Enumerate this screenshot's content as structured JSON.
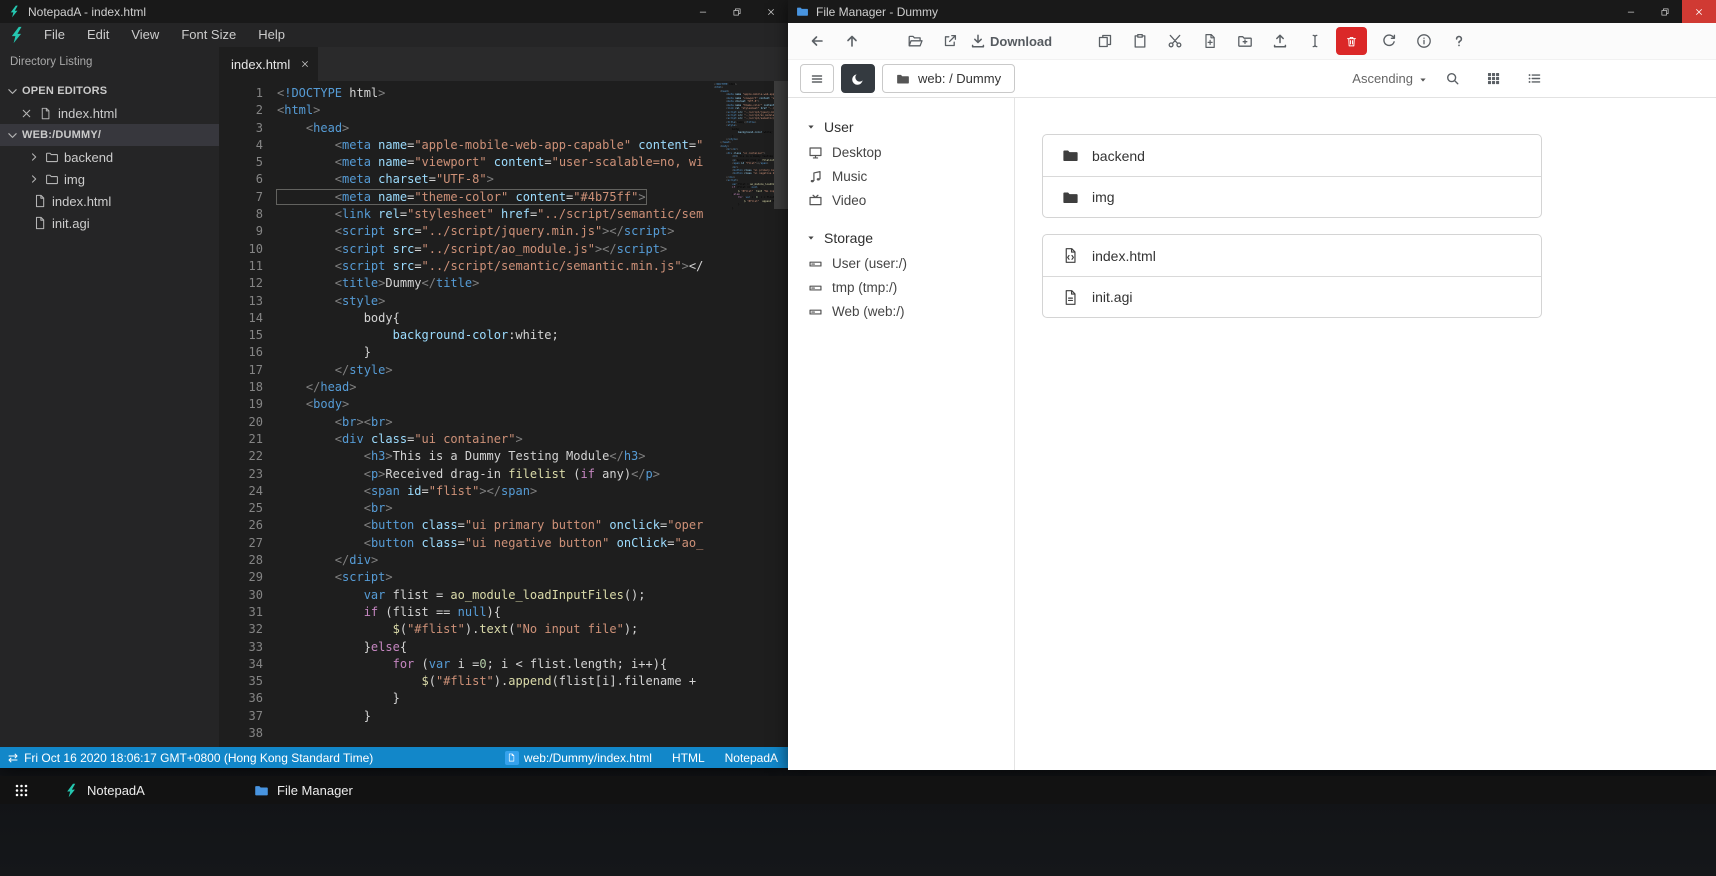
{
  "notepada": {
    "title": "NotepadA - index.html",
    "menu": [
      "File",
      "Edit",
      "View",
      "Font Size",
      "Help"
    ],
    "sidebar_header": "Directory Listing",
    "open_editors_label": "OPEN EDITORS",
    "open_editors": [
      {
        "name": "index.html",
        "icon": "file"
      }
    ],
    "workspace_label": "WEB:/DUMMY/",
    "tree": [
      {
        "name": "backend",
        "icon": "folder"
      },
      {
        "name": "img",
        "icon": "folder"
      },
      {
        "name": "index.html",
        "icon": "file"
      },
      {
        "name": "init.agi",
        "icon": "file"
      }
    ],
    "tab": {
      "label": "index.html"
    },
    "highlight_line": 7,
    "code": [
      "<!DOCTYPE html>",
      "<html>",
      "    <head>",
      "        <meta name=\"apple-mobile-web-app-capable\" content=\"",
      "        <meta name=\"viewport\" content=\"user-scalable=no, wi",
      "        <meta charset=\"UTF-8\">",
      "        <meta name=\"theme-color\" content=\"#4b75ff\">",
      "        <link rel=\"stylesheet\" href=\"../script/semantic/sem",
      "        <script src=\"../script/jquery.min.js\"></script>",
      "        <script src=\"../script/ao_module.js\"></script>",
      "        <script src=\"../script/semantic/semantic.min.js\"></",
      "        <title>Dummy</title>",
      "        <style>",
      "            body{",
      "                background-color:white;",
      "            }",
      "        </style>",
      "    </head>",
      "    <body>",
      "        <br><br>",
      "        <div class=\"ui container\">",
      "            <h3>This is a Dummy Testing Module</h3>",
      "            <p>Received drag-in filelist (if any)</p>",
      "            <span id=\"flist\"></span>",
      "            <br>",
      "            <button class=\"ui primary button\" onclick=\"oper",
      "            <button class=\"ui negative button\" onClick=\"ao_",
      "        </div>",
      "        <script>",
      "            var flist = ao_module_loadInputFiles();",
      "            if (flist == null){",
      "                $(\"#flist\").text(\"No input file\");",
      "            }else{",
      "                for (var i =0; i < flist.length; i++){",
      "                    $(\"#flist\").append(flist[i].filename + ",
      "                }",
      "            }",
      ""
    ],
    "status": {
      "datetime": "Fri Oct 16 2020 18:06:17 GMT+0800 (Hong Kong Standard Time)",
      "path": "web:/Dummy/index.html",
      "language": "HTML",
      "app_name": "NotepadA"
    }
  },
  "filemanager": {
    "title": "File Manager - Dummy",
    "toolbar": [
      {
        "icon": "arrow-left",
        "name": "back-button"
      },
      {
        "icon": "arrow-up",
        "name": "up-button"
      },
      {
        "spacer": true
      },
      {
        "icon": "folder-open",
        "name": "open-button"
      },
      {
        "icon": "external-link",
        "name": "open-in-new-button"
      },
      {
        "icon": "download",
        "name": "download-button",
        "label": "Download"
      },
      {
        "spacer": true
      },
      {
        "icon": "copy",
        "name": "copy-button"
      },
      {
        "icon": "paste",
        "name": "paste-button"
      },
      {
        "icon": "cut",
        "name": "cut-button"
      },
      {
        "icon": "file-plus",
        "name": "new-file-button"
      },
      {
        "icon": "folder-plus",
        "name": "new-folder-button"
      },
      {
        "icon": "upload",
        "name": "upload-button"
      },
      {
        "icon": "i-cursor",
        "name": "rename-button"
      },
      {
        "icon": "trash",
        "name": "delete-button",
        "style": "danger"
      },
      {
        "icon": "refresh",
        "name": "refresh-button"
      },
      {
        "icon": "info",
        "name": "info-button"
      },
      {
        "icon": "question",
        "name": "help-button"
      }
    ],
    "breadcrumb": "web: / Dummy",
    "sort_label": "Ascending",
    "sidebar": [
      {
        "label": "User",
        "items": [
          {
            "name": "Desktop",
            "icon": "desktop"
          },
          {
            "name": "Music",
            "icon": "music"
          },
          {
            "name": "Video",
            "icon": "tv"
          }
        ]
      },
      {
        "label": "Storage",
        "items": [
          {
            "name": "User (user:/)",
            "icon": "hdd"
          },
          {
            "name": "tmp (tmp:/)",
            "icon": "hdd"
          },
          {
            "name": "Web (web:/)",
            "icon": "hdd"
          }
        ]
      }
    ],
    "file_groups": [
      [
        {
          "name": "backend",
          "icon": "folder-dark"
        },
        {
          "name": "img",
          "icon": "folder-dark"
        }
      ],
      [
        {
          "name": "index.html",
          "icon": "file-code"
        },
        {
          "name": "init.agi",
          "icon": "file-alt"
        }
      ]
    ]
  },
  "taskbar": {
    "items": [
      {
        "label": "NotepadA",
        "icon": "notepada-logo"
      },
      {
        "label": "File Manager",
        "icon": "fm-logo"
      }
    ]
  },
  "colors": {
    "accent_teal": "#25c7b0",
    "accent_blue": "#4894e0",
    "statusbar_blue": "#1287c9",
    "danger_red": "#db2828",
    "theme_color_value": "#4b75ff"
  }
}
